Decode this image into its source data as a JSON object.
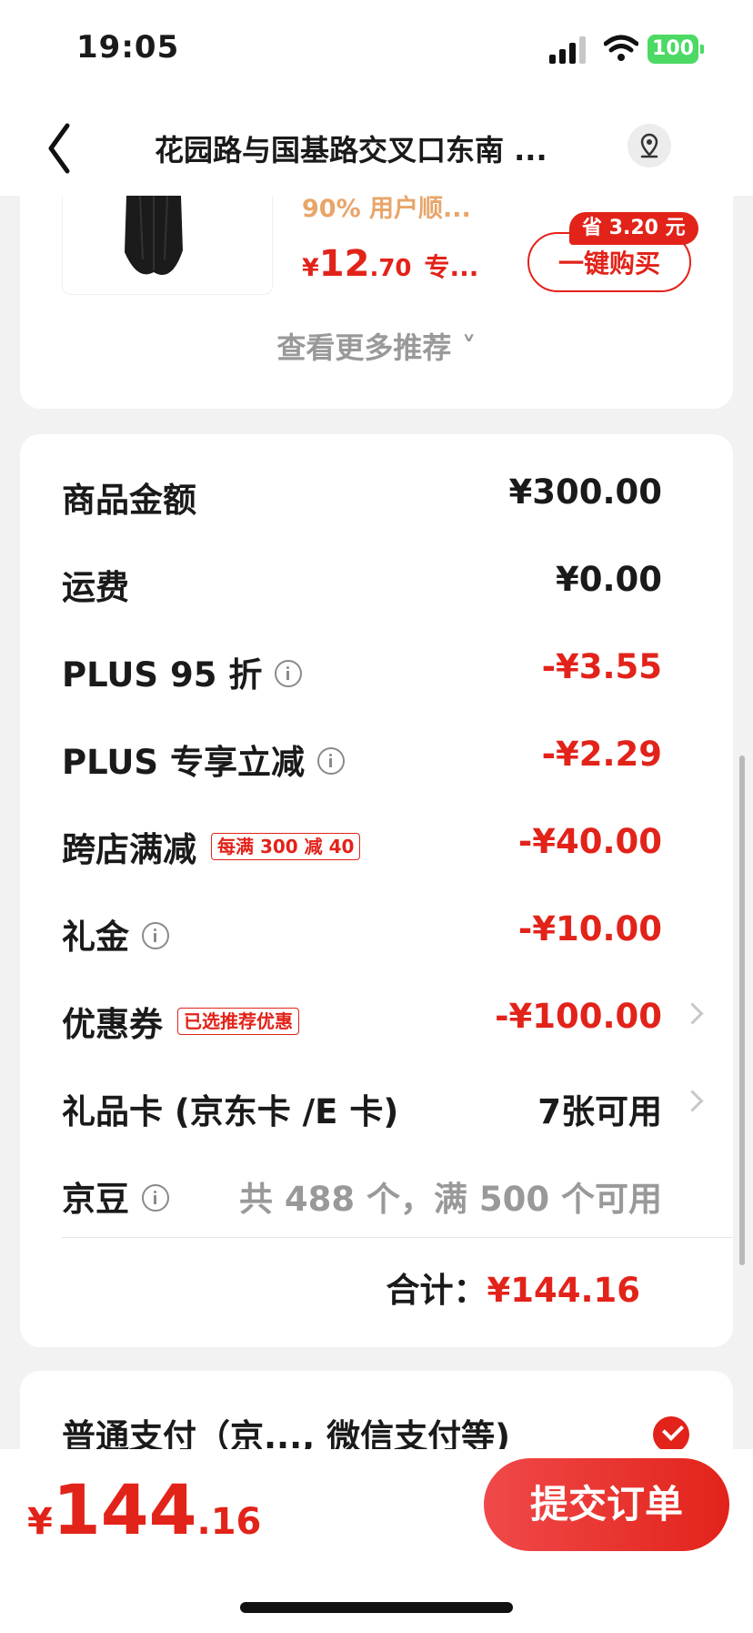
{
  "status_bar": {
    "time": "19:05",
    "battery": "100"
  },
  "nav": {
    "title": "花园路与国基路交叉口东南 ..."
  },
  "recommend": {
    "tip": "90% 用户顺...",
    "price_symbol": "¥",
    "price_int": "12",
    "price_dec": ".70",
    "price_tag": "专...",
    "save_badge": "省 3.20 元",
    "buy_label": "一键购买",
    "more_label": "查看更多推荐 ˅"
  },
  "summary": {
    "rows": [
      {
        "label": "商品金额",
        "value": "¥300.00"
      },
      {
        "label": "运费",
        "value": "¥0.00"
      },
      {
        "label": "PLUS 95 折",
        "value": "-¥3.55"
      },
      {
        "label": "PLUS 专享立减",
        "value": "-¥2.29"
      },
      {
        "label": "跨店满减",
        "badge": "每满 300 减 40",
        "value": "-¥40.00"
      },
      {
        "label": "礼金",
        "value": "-¥10.00"
      },
      {
        "label": "优惠券",
        "badge": "已选推荐优惠",
        "value": "-¥100.00"
      },
      {
        "label": "礼品卡 (京东卡 /E 卡)",
        "value": "7张可用"
      },
      {
        "label": "京豆",
        "value": "共 488 个，满 500 个可用"
      }
    ],
    "total_label": "合计：",
    "total_value": "¥144.16"
  },
  "payment": {
    "label": "普通支付（京..., 微信支付等)"
  },
  "footer": {
    "price_symbol": "¥",
    "price_int": "144",
    "price_dec": ".16",
    "submit_label": "提交订单"
  },
  "colors": {
    "accent": "#e2231a",
    "muted": "#999999",
    "tip": "#e8a56a"
  }
}
